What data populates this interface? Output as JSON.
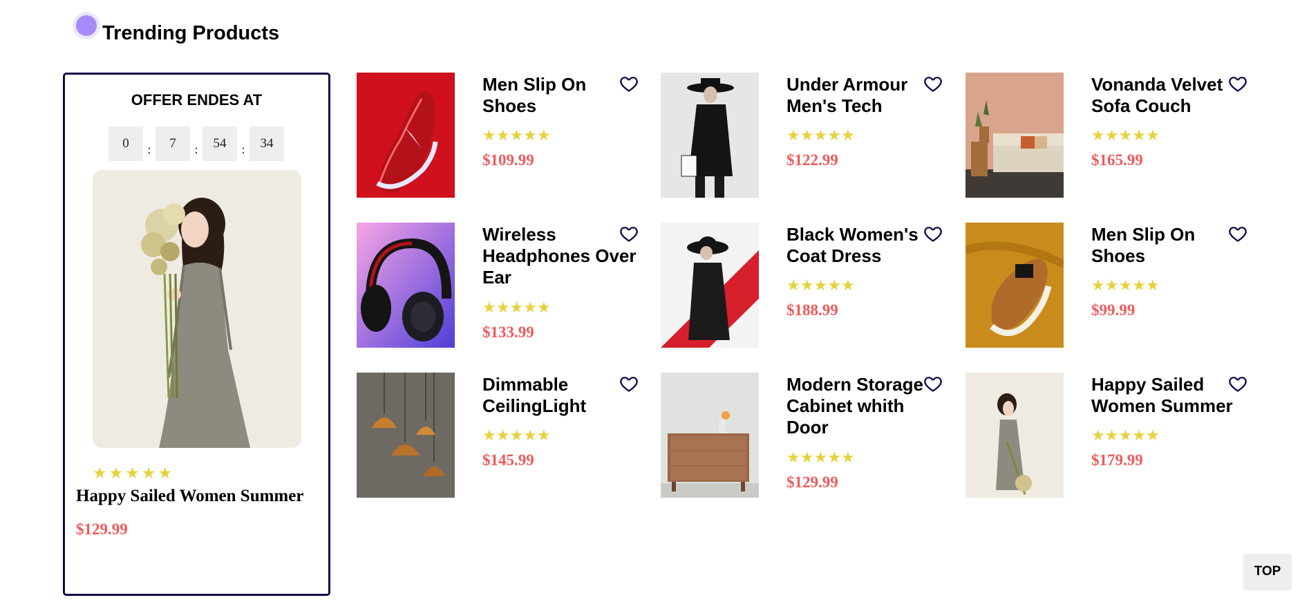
{
  "section": {
    "title": "Trending Products"
  },
  "offer": {
    "heading": "OFFER ENDES AT",
    "countdown": [
      "0",
      "7",
      "54",
      "34"
    ],
    "separator": ":",
    "rating": 5,
    "name": "Happy Sailed Women Summer",
    "price": "$129.99"
  },
  "products": [
    {
      "name": "Men Slip On Shoes",
      "price": "$109.99",
      "rating": 5,
      "image": "red-sneaker"
    },
    {
      "name": "Under Armour Men's Tech",
      "price": "$122.99",
      "rating": 5,
      "image": "man-black-coat"
    },
    {
      "name": "Vonanda Velvet Sofa Couch",
      "price": "$165.99",
      "rating": 5,
      "image": "sofa-room"
    },
    {
      "name": "Wireless Headphones Over Ear",
      "price": "$133.99",
      "rating": 5,
      "image": "headphones"
    },
    {
      "name": "Black Women's Coat Dress",
      "price": "$188.99",
      "rating": 5,
      "image": "woman-black-coat"
    },
    {
      "name": "Men Slip On Shoes",
      "price": "$99.99",
      "rating": 5,
      "image": "tan-sneaker"
    },
    {
      "name": "Dimmable CeilingLight",
      "price": "$145.99",
      "rating": 5,
      "image": "pendant-lights"
    },
    {
      "name": "Modern Storage Cabinet whith Door",
      "price": "$129.99",
      "rating": 5,
      "image": "wood-cabinet"
    },
    {
      "name": "Happy Sailed Women Summer",
      "price": "$179.99",
      "rating": 5,
      "image": "woman-flowers"
    }
  ],
  "top_button": {
    "label": "TOP"
  },
  "colors": {
    "price": "#f05a5a",
    "star": "#e6d23d",
    "border": "#12084a",
    "heart": "#12084a",
    "accent_dot": "#a78bfa"
  }
}
